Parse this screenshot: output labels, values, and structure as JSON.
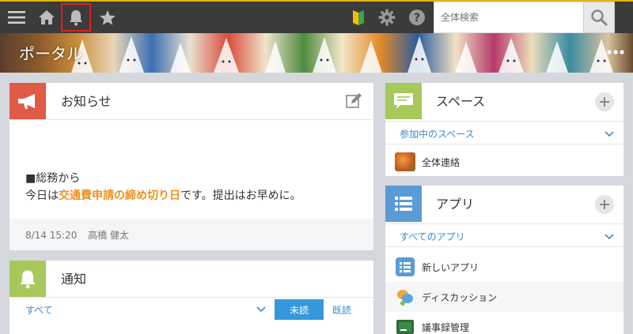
{
  "header": {
    "search_placeholder": "全体検索"
  },
  "banner": {
    "title": "ポータル"
  },
  "notice": {
    "title": "お知らせ",
    "line1": "■総務から",
    "line2_prefix": "今日は",
    "line2_highlight": "交通費申請の締め切り日",
    "line2_suffix": "です。提出はお早めに。",
    "date": "8/14 15:20",
    "author": "高橋 健太",
    "highlight_color": "#f08f1e"
  },
  "notifications": {
    "title": "通知",
    "filter": "すべて",
    "unread_label": "未読",
    "read_label": "既読"
  },
  "space": {
    "title": "スペース",
    "subheader": "参加中のスペース",
    "items": [
      {
        "label": "全体連絡"
      }
    ]
  },
  "apps": {
    "title": "アプリ",
    "subheader": "すべてのアプリ",
    "items": [
      {
        "label": "新しいアプリ",
        "icon": "table-app-icon"
      },
      {
        "label": "ディスカッション",
        "icon": "discussion-icon"
      },
      {
        "label": "議事録管理",
        "icon": "minutes-icon"
      }
    ]
  },
  "colors": {
    "accent_blue": "#3498db",
    "topbar": "#3b3b3b",
    "topbar_border": "#e3b400",
    "notice_red": "#e05a48",
    "green": "#a7c85a",
    "app_blue": "#5b9bd5"
  }
}
